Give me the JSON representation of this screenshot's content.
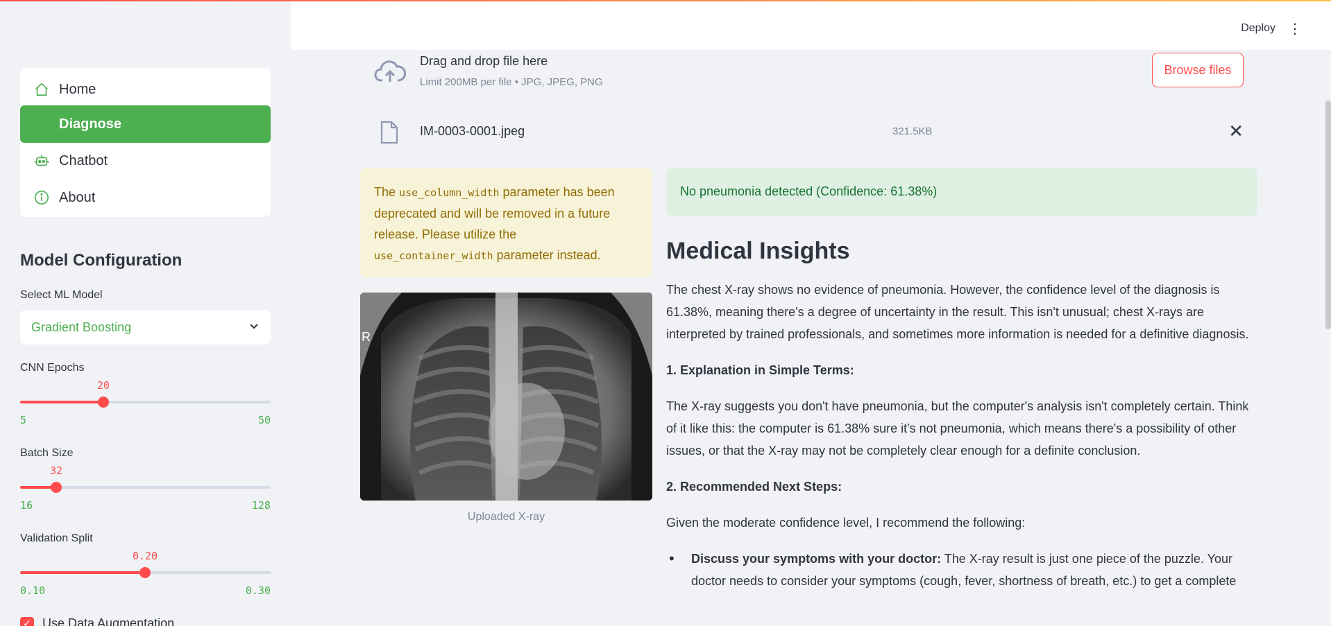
{
  "sidebar": {
    "nav": [
      {
        "label": "Home",
        "icon": "home-icon",
        "active": false
      },
      {
        "label": "Diagnose",
        "icon": "",
        "active": true
      },
      {
        "label": "Chatbot",
        "icon": "robot-icon",
        "active": false
      },
      {
        "label": "About",
        "icon": "info-icon",
        "active": false
      }
    ],
    "section_title": "Model Configuration",
    "model_select": {
      "label": "Select ML Model",
      "value": "Gradient Boosting"
    },
    "sliders": [
      {
        "label": "CNN Epochs",
        "value": "20",
        "min": "5",
        "max": "50",
        "fraction": 0.333
      },
      {
        "label": "Batch Size",
        "value": "32",
        "min": "16",
        "max": "128",
        "fraction": 0.143
      },
      {
        "label": "Validation Split",
        "value": "0.20",
        "min": "0.10",
        "max": "0.30",
        "fraction": 0.5
      }
    ],
    "augmentation": {
      "label": "Use Data Augmentation",
      "checked": true
    }
  },
  "header": {
    "deploy": "Deploy",
    "menu_icon": "⋮"
  },
  "uploader": {
    "title": "Drag and drop file here",
    "hint": "Limit 200MB per file • JPG, JPEG, PNG",
    "browse": "Browse files"
  },
  "file": {
    "name": "IM-0003-0001.jpeg",
    "size": "321.5KB",
    "remove": "✕"
  },
  "warning": {
    "p1": "The ",
    "code1": "use_column_width",
    "p2": " parameter has been deprecated and will be removed in a future release. Please utilize the ",
    "code2": "use_container_width",
    "p3": " parameter instead."
  },
  "image": {
    "caption": "Uploaded X-ray",
    "marker": "R"
  },
  "result": {
    "text": "No pneumonia detected (Confidence: 61.38%)"
  },
  "insights": {
    "title": "Medical Insights",
    "intro": "The chest X-ray shows no evidence of pneumonia. However, the confidence level of the diagnosis is 61.38%, meaning there's a degree of uncertainty in the result. This isn't unusual; chest X-rays are interpreted by trained professionals, and sometimes more information is needed for a definitive diagnosis.",
    "h1": "1. Explanation in Simple Terms:",
    "p1": "The X-ray suggests you don't have pneumonia, but the computer's analysis isn't completely certain. Think of it like this: the computer is 61.38% sure it's not pneumonia, which means there's a possibility of other issues, or that the X-ray may not be completely clear enough for a definite conclusion.",
    "h2": "2. Recommended Next Steps:",
    "p2": "Given the moderate confidence level, I recommend the following:",
    "bullet1_bold": "Discuss your symptoms with your doctor:",
    "bullet1_text": " The X-ray result is just one piece of the puzzle. Your doctor needs to consider your symptoms (cough, fever, shortness of breath, etc.) to get a complete"
  },
  "colors": {
    "accent": "#ff4b4b",
    "green": "#4caf50",
    "success_bg": "#dff0e2",
    "warning_bg": "#f7f3d8"
  }
}
